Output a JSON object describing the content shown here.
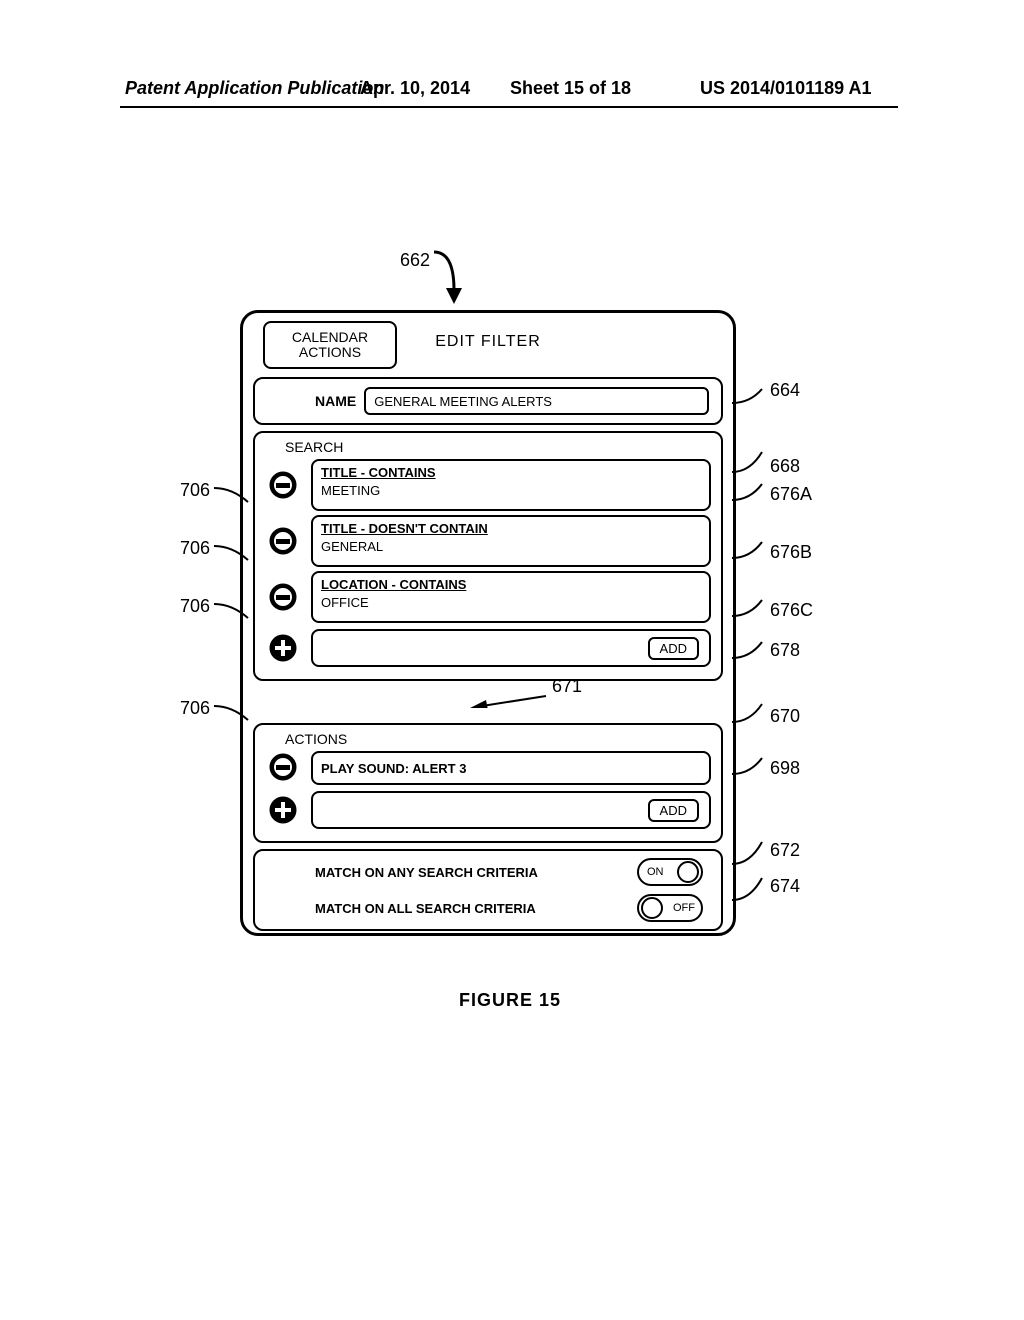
{
  "header": {
    "publication": "Patent Application Publication",
    "date": "Apr. 10, 2014",
    "sheet": "Sheet 15 of 18",
    "docnum": "US 2014/0101189 A1"
  },
  "figure_caption": "FIGURE 15",
  "refs": {
    "r662": "662",
    "r664": "664",
    "r668": "668",
    "r670": "670",
    "r671": "671",
    "r672": "672",
    "r674": "674",
    "r676A": "676A",
    "r676B": "676B",
    "r676C": "676C",
    "r678": "678",
    "r698": "698",
    "r706a": "706",
    "r706b": "706",
    "r706c": "706",
    "r706d": "706"
  },
  "ui": {
    "tab": "CALENDAR\nACTIONS",
    "tab_l1": "CALENDAR",
    "tab_l2": "ACTIONS",
    "title": "EDIT FILTER",
    "name_label": "NAME",
    "name_value": "GENERAL MEETING ALERTS",
    "search_head": "SEARCH",
    "criteria": [
      {
        "head": "TITLE - CONTAINS",
        "value": "MEETING"
      },
      {
        "head": "TITLE - DOESN'T CONTAIN",
        "value": "GENERAL"
      },
      {
        "head": "LOCATION - CONTAINS",
        "value": "OFFICE"
      }
    ],
    "add_label": "ADD",
    "actions_head": "ACTIONS",
    "action_item": "PLAY SOUND: ALERT 3",
    "match_any": "MATCH ON ANY SEARCH CRITERIA",
    "match_all": "MATCH ON ALL SEARCH CRITERIA",
    "on": "ON",
    "off": "OFF"
  }
}
